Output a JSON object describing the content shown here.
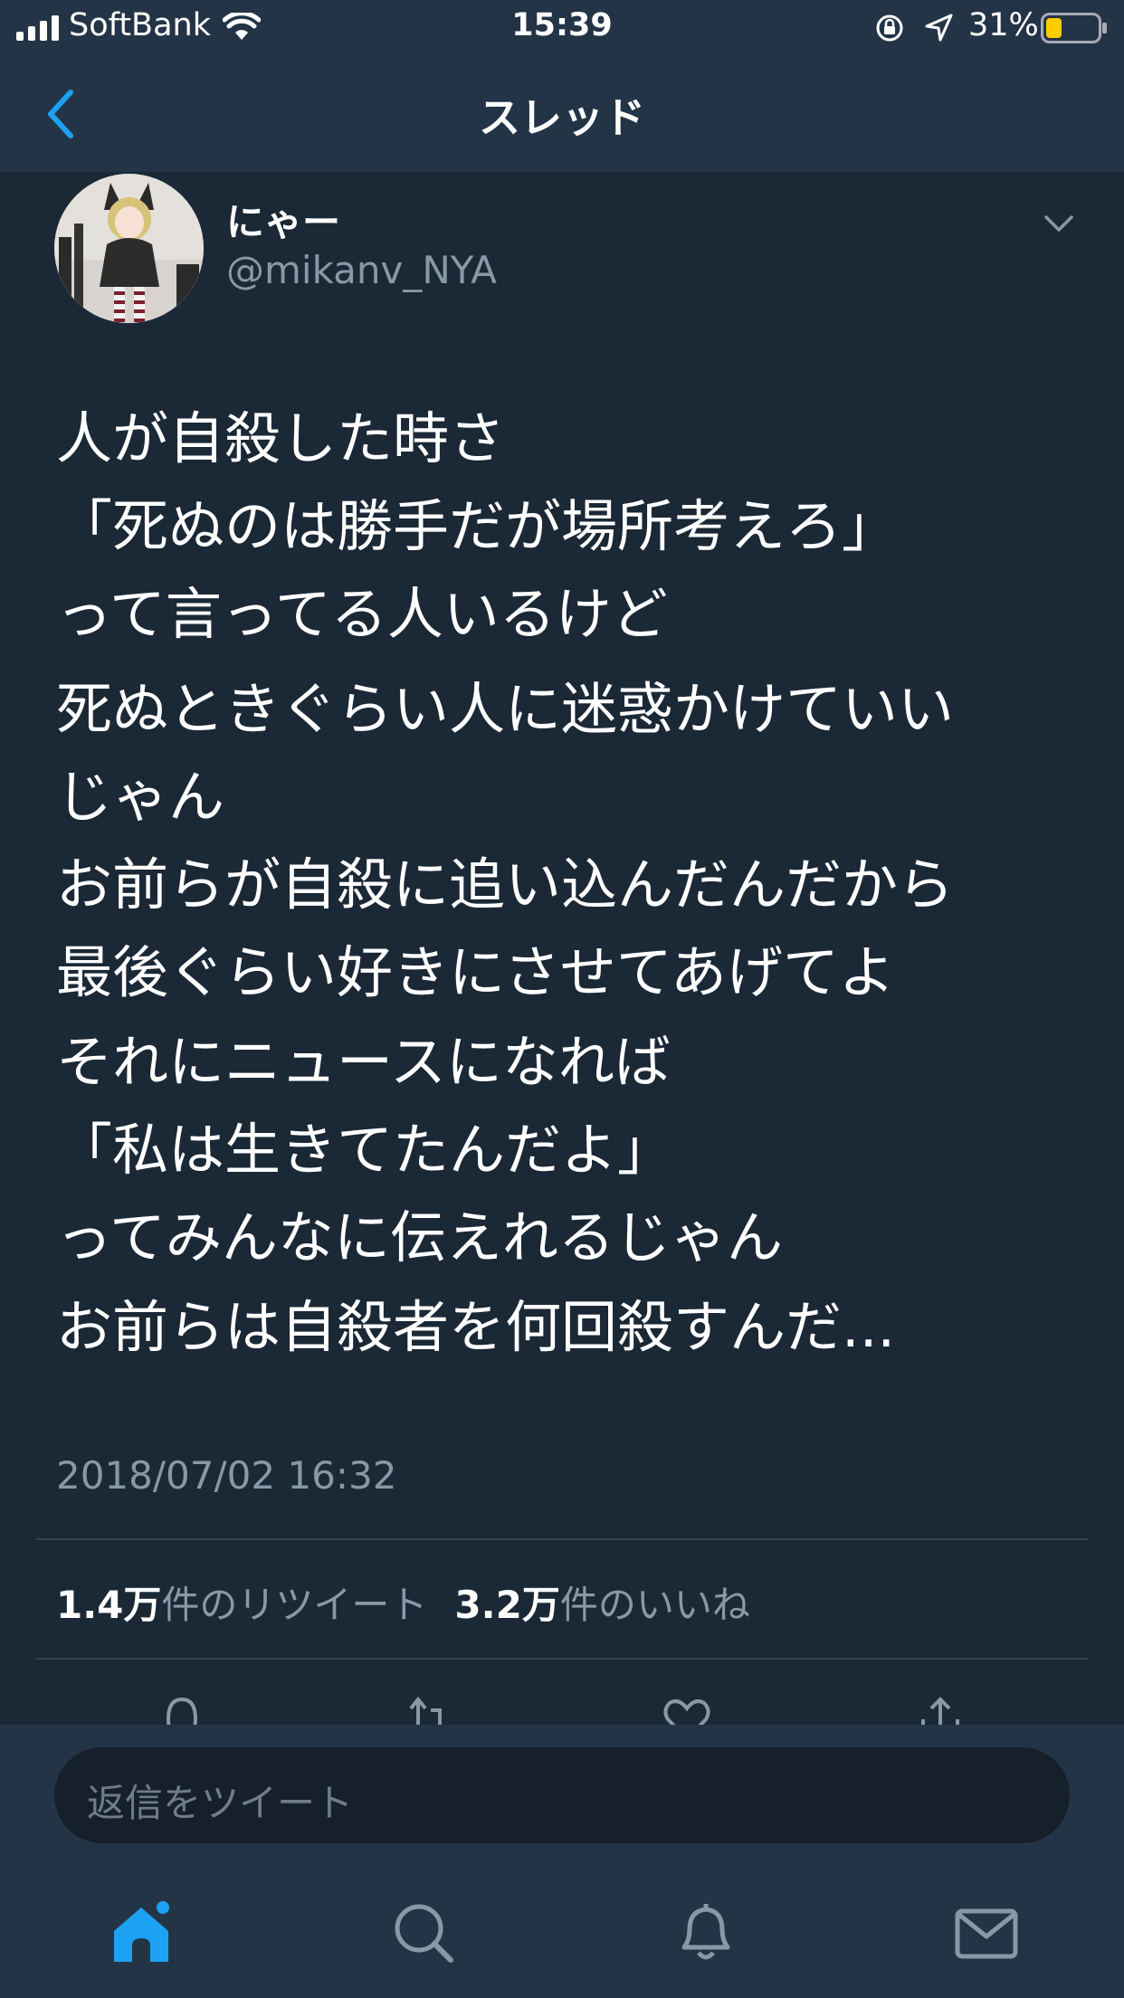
{
  "status_bar": {
    "carrier": "SoftBank",
    "time": "15:39",
    "battery_percent": "31%",
    "battery_level": 0.31
  },
  "nav": {
    "title": "スレッド",
    "back_icon": "chevron-left-icon"
  },
  "tweet": {
    "user_name": "にゃー",
    "user_handle": "@mikanv_NYA",
    "paragraphs": [
      "人が自殺した時さ\n「死ぬのは勝手だが場所考えろ」\nって言ってる人いるけど",
      "死ぬときぐらい人に迷惑かけていい\nじゃん\nお前らが自殺に追い込んだんだから\n最後ぐらい好きにさせてあげてよ",
      "それにニュースになれば\n「私は生きてたんだよ」\nってみんなに伝えれるじゃん",
      "お前らは自殺者を何回殺すんだ..."
    ],
    "timestamp": "2018/07/02 16:32",
    "stats": {
      "retweet_count": "1.4万",
      "retweet_label": "件のリツイート",
      "like_count": "3.2万",
      "like_label": "件のいいね"
    },
    "actions": [
      "reply-icon",
      "retweet-icon",
      "like-icon",
      "share-icon"
    ]
  },
  "reply": {
    "placeholder": "返信をツイート"
  },
  "tabbar": {
    "items": [
      "home-icon",
      "search-icon",
      "notifications-icon",
      "messages-icon"
    ],
    "active": "home-icon"
  },
  "colors": {
    "background": "#1b2836",
    "bar": "#243447",
    "accent": "#1da1f2",
    "secondary_text": "#8899a6",
    "battery": "#ffcc00"
  }
}
